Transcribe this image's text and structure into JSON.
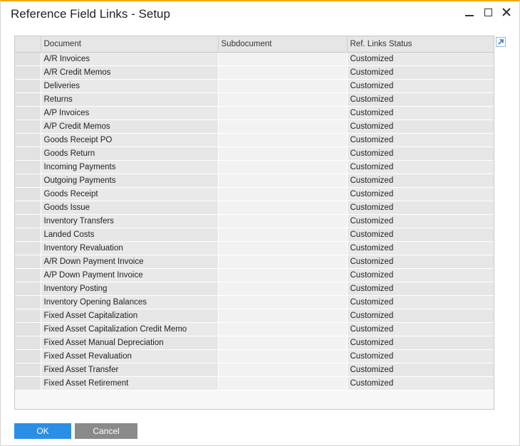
{
  "window": {
    "title": "Reference Field Links - Setup"
  },
  "grid": {
    "columns": [
      "",
      "Document",
      "Subdocument",
      "Ref. Links Status"
    ],
    "rows": [
      {
        "document": "A/R Invoices",
        "subdocument": "",
        "status": "Customized"
      },
      {
        "document": "A/R Credit Memos",
        "subdocument": "",
        "status": "Customized"
      },
      {
        "document": "Deliveries",
        "subdocument": "",
        "status": "Customized"
      },
      {
        "document": "Returns",
        "subdocument": "",
        "status": "Customized"
      },
      {
        "document": "A/P Invoices",
        "subdocument": "",
        "status": "Customized"
      },
      {
        "document": "A/P Credit Memos",
        "subdocument": "",
        "status": "Customized"
      },
      {
        "document": "Goods Receipt PO",
        "subdocument": "",
        "status": "Customized"
      },
      {
        "document": "Goods Return",
        "subdocument": "",
        "status": "Customized"
      },
      {
        "document": "Incoming Payments",
        "subdocument": "",
        "status": "Customized"
      },
      {
        "document": "Outgoing Payments",
        "subdocument": "",
        "status": "Customized"
      },
      {
        "document": "Goods Receipt",
        "subdocument": "",
        "status": "Customized"
      },
      {
        "document": "Goods Issue",
        "subdocument": "",
        "status": "Customized"
      },
      {
        "document": "Inventory Transfers",
        "subdocument": "",
        "status": "Customized"
      },
      {
        "document": "Landed Costs",
        "subdocument": "",
        "status": "Customized"
      },
      {
        "document": "Inventory Revaluation",
        "subdocument": "",
        "status": "Customized"
      },
      {
        "document": "A/R Down Payment Invoice",
        "subdocument": "",
        "status": "Customized"
      },
      {
        "document": "A/P Down Payment Invoice",
        "subdocument": "",
        "status": "Customized"
      },
      {
        "document": "Inventory Posting",
        "subdocument": "",
        "status": "Customized"
      },
      {
        "document": "Inventory Opening Balances",
        "subdocument": "",
        "status": "Customized"
      },
      {
        "document": "Fixed Asset Capitalization",
        "subdocument": "",
        "status": "Customized"
      },
      {
        "document": "Fixed Asset Capitalization Credit Memo",
        "subdocument": "",
        "status": "Customized"
      },
      {
        "document": "Fixed Asset Manual Depreciation",
        "subdocument": "",
        "status": "Customized"
      },
      {
        "document": "Fixed Asset Revaluation",
        "subdocument": "",
        "status": "Customized"
      },
      {
        "document": "Fixed Asset Transfer",
        "subdocument": "",
        "status": "Customized"
      },
      {
        "document": "Fixed Asset Retirement",
        "subdocument": "",
        "status": "Customized"
      }
    ]
  },
  "buttons": {
    "ok": "OK",
    "cancel": "Cancel"
  },
  "icons": {
    "minimize": "minimize-icon",
    "maximize": "maximize-icon",
    "close": "close-icon",
    "expand": "expand-arrow-icon"
  },
  "colors": {
    "title_accent": "#f0ab00",
    "ok_button": "#2b8ee6",
    "cancel_button": "#8a8a8a",
    "expand_arrow": "#2b7bd0"
  }
}
